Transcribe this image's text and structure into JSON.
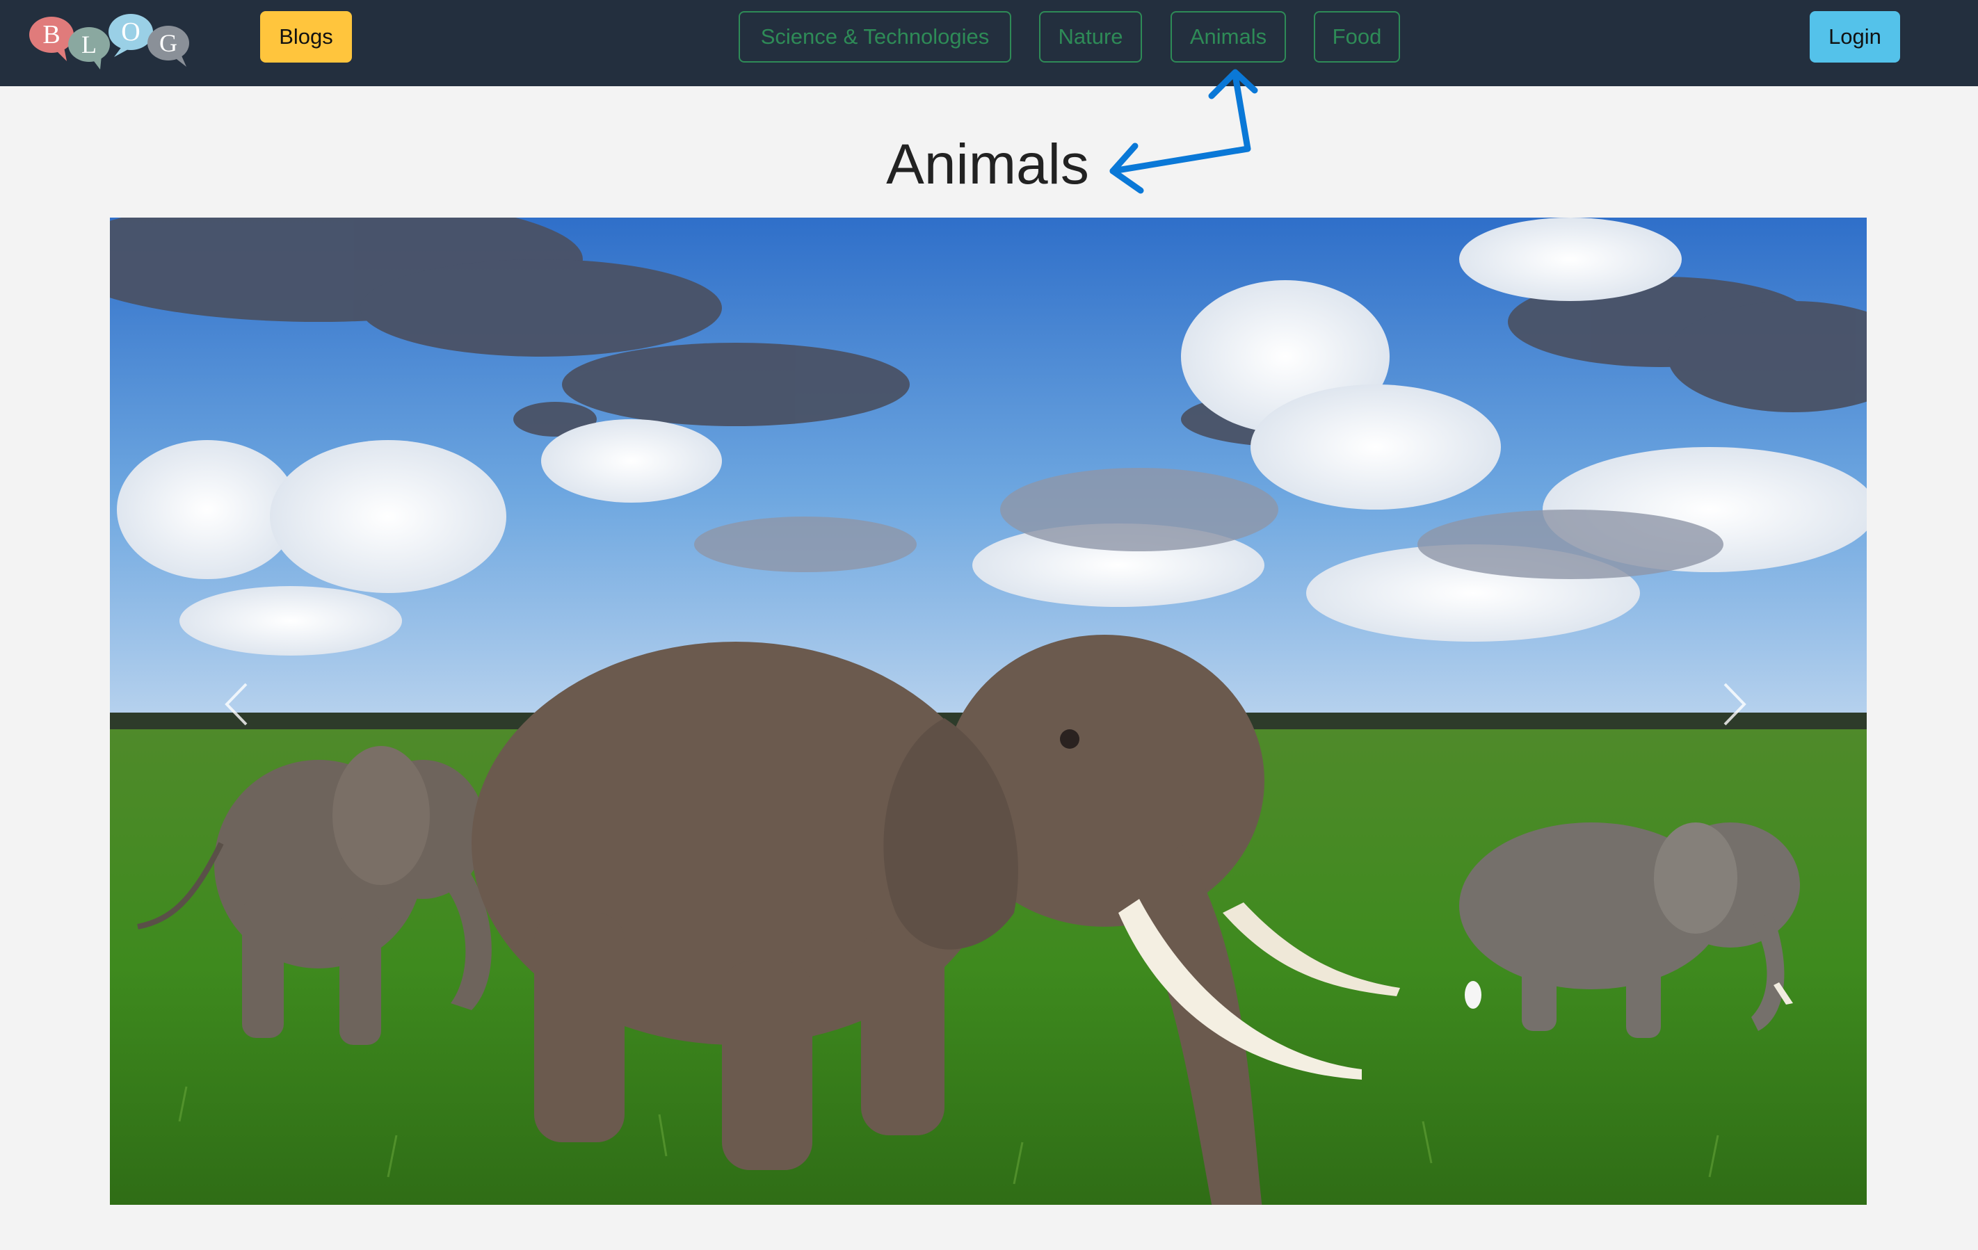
{
  "navbar": {
    "logo_letters": [
      "B",
      "L",
      "O",
      "G"
    ],
    "blogs_label": "Blogs",
    "categories": [
      {
        "label": "Science & Technologies"
      },
      {
        "label": "Nature"
      },
      {
        "label": "Animals"
      },
      {
        "label": "Food"
      }
    ],
    "login_label": "Login"
  },
  "main": {
    "title": "Animals",
    "hero_icons": {
      "prev": "chevron-left-icon",
      "next": "chevron-right-icon"
    }
  },
  "colors": {
    "navbar_bg": "#232f3e",
    "blogs_button": "#ffc53d",
    "category_outline": "#2e8b57",
    "login_button": "#54c2ea",
    "annotation_arrow": "#0a78d7",
    "page_bg": "#f3f3f3"
  }
}
